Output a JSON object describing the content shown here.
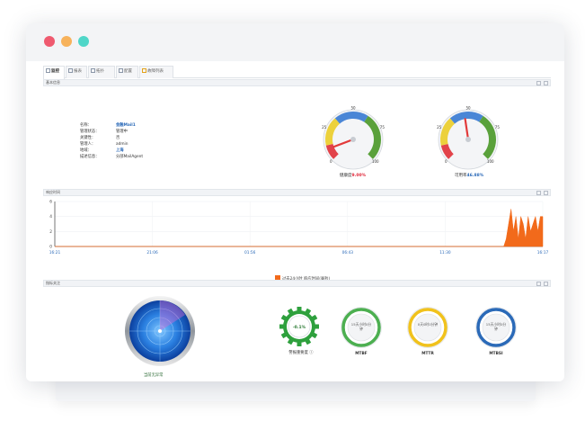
{
  "window": {
    "tabs": [
      {
        "label": "监控",
        "active": true
      },
      {
        "label": "报表",
        "active": false
      },
      {
        "label": "拓扑",
        "active": false
      },
      {
        "label": "配置",
        "active": false
      },
      {
        "label": "故障列表",
        "active": false
      }
    ]
  },
  "basic_info": {
    "section_title": "基本信息",
    "rows": [
      {
        "label": "名称：",
        "value": "金融Mail1"
      },
      {
        "label": "管理状态：",
        "value": "管理中"
      },
      {
        "label": "关键性：",
        "value": "否"
      },
      {
        "label": "管理人：",
        "value": "admin"
      },
      {
        "label": "地域：",
        "value": "上海"
      },
      {
        "label": "描述信息：",
        "value": "分部MailAgent"
      }
    ],
    "gauges": [
      {
        "name": "健康度",
        "value_text": "9.00%",
        "value": 9.0,
        "ticks": [
          "0",
          "25",
          "50",
          "75",
          "100"
        ]
      },
      {
        "name": "可用率",
        "value_text": "46.88%",
        "value": 46.88,
        "ticks": [
          "0",
          "25",
          "50",
          "75",
          "100"
        ]
      }
    ],
    "colors": {
      "green": "#5aa13b",
      "yellow": "#ecd13c",
      "red": "#e2434a",
      "blue": "#4a86d6",
      "needle": "#e23a3a"
    }
  },
  "response_time": {
    "section_title": "响应时间",
    "chart_data": {
      "type": "area",
      "title": "",
      "x_ticks": [
        "16:21",
        "21:06",
        "01:56",
        "06:43",
        "11:30",
        "16:17"
      ],
      "y_ticks": [
        "0",
        "2",
        "4",
        "6"
      ],
      "ylim": [
        0,
        6
      ],
      "series": [
        {
          "name": "过去24小时 响应时间(毫秒)",
          "color": "#f26a1b",
          "x": [
            0.0,
            0.92,
            0.925,
            0.93,
            0.935,
            0.94,
            0.945,
            0.95,
            0.955,
            0.96,
            0.965,
            0.97,
            0.975,
            0.98,
            0.985,
            0.99,
            0.995,
            1.0
          ],
          "values": [
            0,
            0,
            1,
            3,
            5,
            2,
            4,
            1,
            4,
            3,
            1,
            4,
            2,
            3,
            4,
            2,
            4,
            4
          ]
        }
      ],
      "grid": true
    },
    "legend_label": "过去24小时 响应时间(毫秒)"
  },
  "indicators": {
    "section_title": "指标关注",
    "radar_label": "当前无异常",
    "gear": {
      "value_text": "-0.1%",
      "name": "警报重要度",
      "color": "#2ea03d"
    },
    "badges": [
      {
        "name": "MTBF",
        "text": "15天小时0分钟",
        "ring": "#4caf50"
      },
      {
        "name": "MTTR",
        "text": "0天0时0分钟",
        "ring": "#f1c21c"
      },
      {
        "name": "MTBSI",
        "text": "15天小时0分钟",
        "ring": "#2b6ab8"
      }
    ]
  }
}
